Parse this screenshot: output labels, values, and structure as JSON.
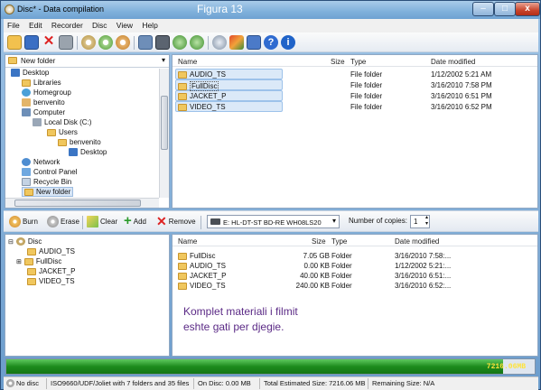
{
  "window": {
    "title": "Disc* - Data compilation",
    "figure_label": "Figura 13"
  },
  "menu": [
    "File",
    "Edit",
    "Recorder",
    "Disc",
    "View",
    "Help"
  ],
  "folder_combo": {
    "value": "New folder"
  },
  "explorer_tree": [
    {
      "label": "Desktop"
    },
    {
      "label": "Libraries"
    },
    {
      "label": "Homegroup"
    },
    {
      "label": "benvenito"
    },
    {
      "label": "Computer"
    },
    {
      "label": "Local Disk (C:)"
    },
    {
      "label": "Users"
    },
    {
      "label": "benvenito"
    },
    {
      "label": "Desktop"
    },
    {
      "label": "Network"
    },
    {
      "label": "Control Panel"
    },
    {
      "label": "Recycle Bin"
    },
    {
      "label": "New folder"
    }
  ],
  "files_top": {
    "columns": {
      "name": "Name",
      "size": "Size",
      "type": "Type",
      "date": "Date modified"
    },
    "rows": [
      {
        "name": "AUDIO_TS",
        "type": "File folder",
        "date": "1/12/2002 5:21 AM"
      },
      {
        "name": "FullDisc",
        "type": "File folder",
        "date": "3/16/2010 7:58 PM"
      },
      {
        "name": "JACKET_P",
        "type": "File folder",
        "date": "3/16/2010 6:51 PM"
      },
      {
        "name": "VIDEO_TS",
        "type": "File folder",
        "date": "3/16/2010 6:52 PM"
      }
    ]
  },
  "burn_toolbar": {
    "burn": "Burn",
    "erase": "Erase",
    "clear": "Clear",
    "add": "Add",
    "remove": "Remove",
    "drive": "E: HL-DT-ST BD-RE  WH08LS20",
    "copies_label": "Number of copies:",
    "copies_value": "1"
  },
  "disc_tree": [
    {
      "label": "Disc"
    },
    {
      "label": "AUDIO_TS"
    },
    {
      "label": "FullDisc"
    },
    {
      "label": "JACKET_P"
    },
    {
      "label": "VIDEO_TS"
    }
  ],
  "files_bottom": {
    "columns": {
      "name": "Name",
      "size": "Size",
      "type": "Type",
      "date": "Date modified"
    },
    "rows": [
      {
        "name": "FullDisc",
        "size": "7.05 GB",
        "type": "Folder",
        "date": "3/16/2010 7:58:..."
      },
      {
        "name": "AUDIO_TS",
        "size": "0.00 KB",
        "type": "Folder",
        "date": "1/12/2002 5:21:..."
      },
      {
        "name": "JACKET_P",
        "size": "40.00 KB",
        "type": "Folder",
        "date": "3/16/2010 6:51:..."
      },
      {
        "name": "VIDEO_TS",
        "size": "240.00 KB",
        "type": "Folder",
        "date": "3/16/2010 6:52:..."
      }
    ]
  },
  "annotation": {
    "line1": "Komplet materiali i filmit",
    "line2": "eshte gati per djegie."
  },
  "progress": {
    "text": "7216.06MB",
    "fill_fraction": 0.94
  },
  "status": {
    "disc": "No disc",
    "format": "ISO9660/UDF/Joliet with 7 folders and 35 files",
    "on_disc": "On Disc: 0.00 MB",
    "total": "Total Estimated Size: 7216.06 MB",
    "remaining": "Remaining Size: N/A"
  }
}
